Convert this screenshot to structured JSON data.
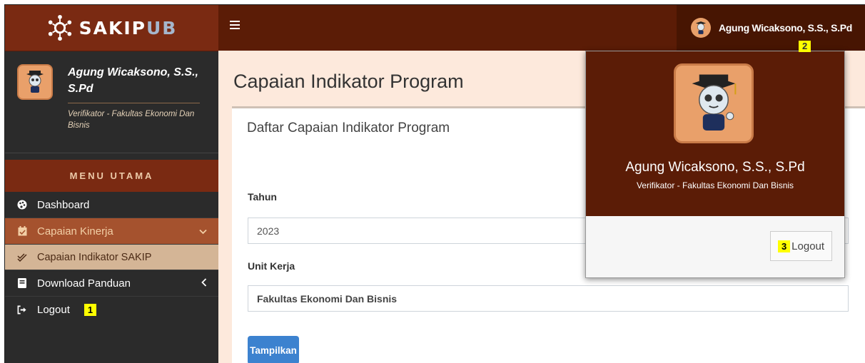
{
  "brand": {
    "name_main": "SAKIP",
    "name_accent": "UB"
  },
  "user": {
    "name": "Agung Wicaksono, S.S., S.Pd",
    "role": "Verifikator - Fakultas Ekonomi Dan Bisnis"
  },
  "sidebar": {
    "user_name": "Agung Wicaksono, S.S., S.Pd",
    "user_role": "Verifikator - Fakultas Ekonomi Dan Bisnis",
    "menu_header": "MENU UTAMA",
    "items": [
      {
        "label": "Dashboard",
        "icon": "palette-icon"
      },
      {
        "label": "Capaian Kinerja",
        "icon": "calendar-check-icon"
      },
      {
        "label": "Capaian Indikator SAKIP",
        "icon": "double-check-icon"
      },
      {
        "label": "Download Panduan",
        "icon": "book-icon"
      },
      {
        "label": "Logout",
        "icon": "sign-out-icon"
      }
    ]
  },
  "page": {
    "title": "Capaian Indikator Program"
  },
  "card": {
    "title": "Daftar Capaian Indikator Program",
    "year_label": "Tahun",
    "year_value": "2023",
    "unit_label": "Unit Kerja",
    "unit_value": "Fakultas Ekonomi Dan Bisnis",
    "show_button": "Tampilkan"
  },
  "popup": {
    "name": "Agung Wicaksono, S.S., S.Pd",
    "role": "Verifikator - Fakultas Ekonomi Dan Bisnis",
    "logout": "Logout"
  },
  "markers": {
    "m1": "1",
    "m2": "2",
    "m3": "3"
  },
  "colors": {
    "header": "#5b1c06",
    "brand_bg": "#7a2a12",
    "active": "#a5522e",
    "button": "#3c82cf"
  }
}
